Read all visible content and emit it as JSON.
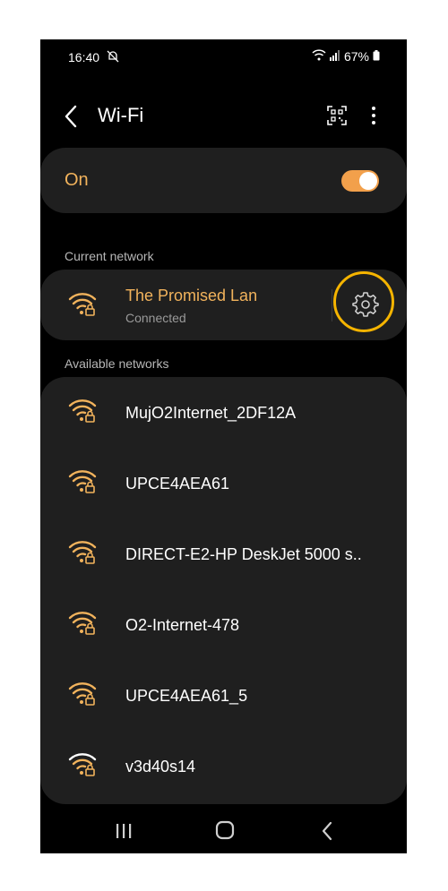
{
  "status_bar": {
    "time": "16:40",
    "battery": "67%",
    "icons": [
      "dnd-off-icon",
      "wifi-icon",
      "signal-icon",
      "battery-icon"
    ]
  },
  "header": {
    "title": "Wi-Fi",
    "icons": [
      "back-icon",
      "qr-code-icon",
      "more-options-icon"
    ]
  },
  "wifi_toggle": {
    "label": "On",
    "enabled": true
  },
  "current_network": {
    "section_label": "Current network",
    "name": "The Promised Lan",
    "status": "Connected",
    "icon": "wifi-lock-icon",
    "settings_icon": "gear-icon"
  },
  "available_networks": {
    "section_label": "Available networks",
    "items": [
      {
        "name": "MujO2Internet_2DF12A"
      },
      {
        "name": "UPCE4AEA61"
      },
      {
        "name": "DIRECT-E2-HP DeskJet 5000 s.."
      },
      {
        "name": "O2-Internet-478"
      },
      {
        "name": "UPCE4AEA61_5"
      },
      {
        "name": "v3d40s14"
      }
    ]
  },
  "nav_bar": {
    "icons": [
      "recent-apps-icon",
      "home-icon",
      "nav-back-icon"
    ]
  },
  "colors": {
    "accent": "#f2b35c",
    "toggle_on": "#f2a04b",
    "highlight": "#f5b400",
    "card": "#1f1f1f",
    "background": "#000000"
  }
}
